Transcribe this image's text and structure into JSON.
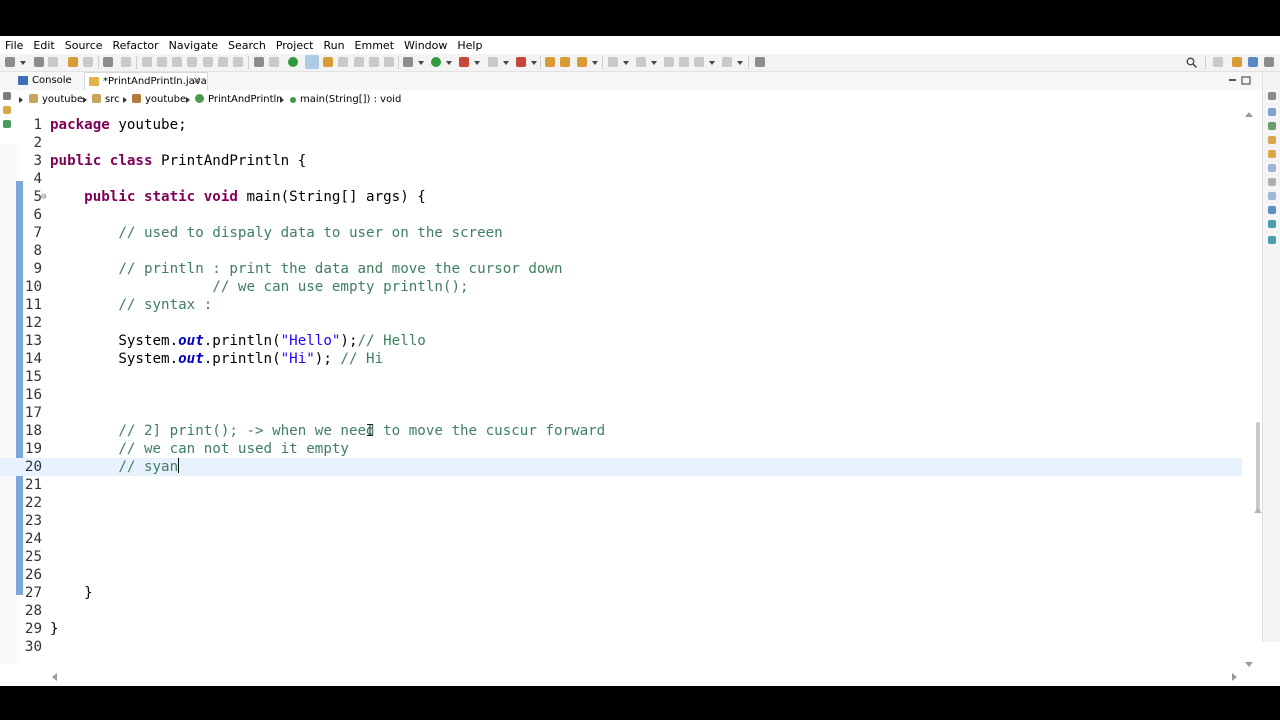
{
  "menu": [
    "File",
    "Edit",
    "Source",
    "Refactor",
    "Navigate",
    "Search",
    "Project",
    "Run",
    "Emmet",
    "Window",
    "Help"
  ],
  "tabs": {
    "console": "Console",
    "editor": "*PrintAndPrintln.java",
    "close_glyph": "✕"
  },
  "breadcrumb": {
    "project": "youtube",
    "folder": "src",
    "package": "youtube",
    "class": "PrintAndPrintln",
    "method": "main(String[]) : void"
  },
  "editor": {
    "current_line": 20,
    "lines": [
      {
        "n": "1",
        "segs": [
          {
            "t": "package",
            "c": "kw"
          },
          {
            "t": " youtube;",
            "c": ""
          }
        ]
      },
      {
        "n": "2",
        "segs": []
      },
      {
        "n": "3",
        "segs": [
          {
            "t": "public",
            "c": "kw"
          },
          {
            "t": " ",
            "c": ""
          },
          {
            "t": "class",
            "c": "kw"
          },
          {
            "t": " PrintAndPrintln {",
            "c": ""
          }
        ]
      },
      {
        "n": "4",
        "segs": []
      },
      {
        "n": "5",
        "fold": "⊖",
        "segs": [
          {
            "t": "    ",
            "c": ""
          },
          {
            "t": "public",
            "c": "kw"
          },
          {
            "t": " ",
            "c": ""
          },
          {
            "t": "static",
            "c": "kw"
          },
          {
            "t": " ",
            "c": ""
          },
          {
            "t": "void",
            "c": "kw"
          },
          {
            "t": " main(String[] args) {",
            "c": ""
          }
        ]
      },
      {
        "n": "6",
        "segs": []
      },
      {
        "n": "7",
        "segs": [
          {
            "t": "        ",
            "c": ""
          },
          {
            "t": "// used to dispaly data to user on the screen",
            "c": "cm"
          }
        ]
      },
      {
        "n": "8",
        "segs": []
      },
      {
        "n": "9",
        "segs": [
          {
            "t": "        ",
            "c": ""
          },
          {
            "t": "// println : print the data and move the cursor down",
            "c": "cm"
          }
        ]
      },
      {
        "n": "10",
        "segs": [
          {
            "t": "                   ",
            "c": ""
          },
          {
            "t": "// we can use empty println();",
            "c": "cm"
          }
        ]
      },
      {
        "n": "11",
        "segs": [
          {
            "t": "        ",
            "c": ""
          },
          {
            "t": "// syntax :",
            "c": "cm"
          }
        ]
      },
      {
        "n": "12",
        "segs": []
      },
      {
        "n": "13",
        "segs": [
          {
            "t": "        System.",
            "c": ""
          },
          {
            "t": "out",
            "c": "it"
          },
          {
            "t": ".println(",
            "c": ""
          },
          {
            "t": "\"Hello\"",
            "c": "st"
          },
          {
            "t": ");",
            "c": ""
          },
          {
            "t": "// Hello",
            "c": "cm"
          }
        ]
      },
      {
        "n": "14",
        "segs": [
          {
            "t": "        System.",
            "c": ""
          },
          {
            "t": "out",
            "c": "it"
          },
          {
            "t": ".println(",
            "c": ""
          },
          {
            "t": "\"Hi\"",
            "c": "st"
          },
          {
            "t": "); ",
            "c": ""
          },
          {
            "t": "// Hi",
            "c": "cm"
          }
        ]
      },
      {
        "n": "15",
        "segs": []
      },
      {
        "n": "16",
        "segs": []
      },
      {
        "n": "17",
        "segs": []
      },
      {
        "n": "18",
        "segs": [
          {
            "t": "        ",
            "c": ""
          },
          {
            "t": "// 2] print(); -> when we need to move the cuscur forward",
            "c": "cm"
          }
        ]
      },
      {
        "n": "19",
        "segs": [
          {
            "t": "        ",
            "c": ""
          },
          {
            "t": "// we can not used it empty",
            "c": "cm"
          }
        ]
      },
      {
        "n": "20",
        "segs": [
          {
            "t": "        ",
            "c": ""
          },
          {
            "t": "// syan",
            "c": "cm"
          }
        ],
        "caret": true
      },
      {
        "n": "21",
        "segs": []
      },
      {
        "n": "22",
        "segs": []
      },
      {
        "n": "23",
        "segs": []
      },
      {
        "n": "24",
        "segs": []
      },
      {
        "n": "25",
        "segs": []
      },
      {
        "n": "26",
        "segs": []
      },
      {
        "n": "27",
        "segs": [
          {
            "t": "    }",
            "c": ""
          }
        ]
      },
      {
        "n": "28",
        "segs": []
      },
      {
        "n": "29",
        "segs": [
          {
            "t": "}",
            "c": ""
          }
        ]
      },
      {
        "n": "30",
        "segs": []
      }
    ]
  },
  "colors": {
    "keyword": "#7f0055",
    "comment": "#3f7f5f",
    "string": "#2a00ff",
    "field": "#0000c0",
    "current_line": "#e8f2fe"
  }
}
